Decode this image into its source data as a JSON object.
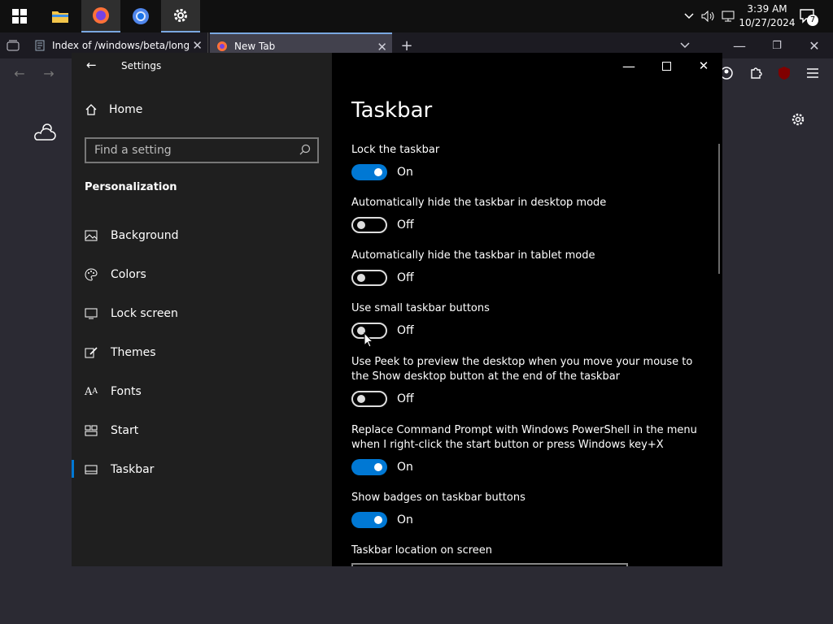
{
  "clock": {
    "time": "3:39 AM",
    "date": "10/27/2024",
    "notif_count": "7"
  },
  "browser": {
    "tabs": [
      {
        "label": "Index of /windows/beta/longhorn"
      },
      {
        "label": "New Tab"
      }
    ]
  },
  "settings": {
    "title": "Settings",
    "home": "Home",
    "search_placeholder": "Find a setting",
    "section": "Personalization",
    "nav": [
      {
        "label": "Background",
        "icon": "image-icon"
      },
      {
        "label": "Colors",
        "icon": "palette-icon"
      },
      {
        "label": "Lock screen",
        "icon": "monitor-icon"
      },
      {
        "label": "Themes",
        "icon": "brush-icon"
      },
      {
        "label": "Fonts",
        "icon": "font-icon"
      },
      {
        "label": "Start",
        "icon": "start-icon"
      },
      {
        "label": "Taskbar",
        "icon": "taskbar-icon",
        "selected": true
      }
    ],
    "page_title": "Taskbar",
    "options": [
      {
        "label": "Lock the taskbar",
        "state": "On"
      },
      {
        "label": "Automatically hide the taskbar in desktop mode",
        "state": "Off"
      },
      {
        "label": "Automatically hide the taskbar in tablet mode",
        "state": "Off"
      },
      {
        "label": "Use small taskbar buttons",
        "state": "Off"
      },
      {
        "label": "Use Peek to preview the desktop when you move your mouse to the Show desktop button at the end of the taskbar",
        "state": "Off"
      },
      {
        "label": "Replace Command Prompt with Windows PowerShell in the menu when I right-click the start button or press Windows key+X",
        "state": "On"
      },
      {
        "label": "Show badges on taskbar buttons",
        "state": "On"
      }
    ],
    "location_label": "Taskbar location on screen"
  },
  "colors": {
    "accent": "#0078d4",
    "panel_left": "#1f1f1f",
    "panel_right": "#000000",
    "desktop": "#2b2a33"
  }
}
